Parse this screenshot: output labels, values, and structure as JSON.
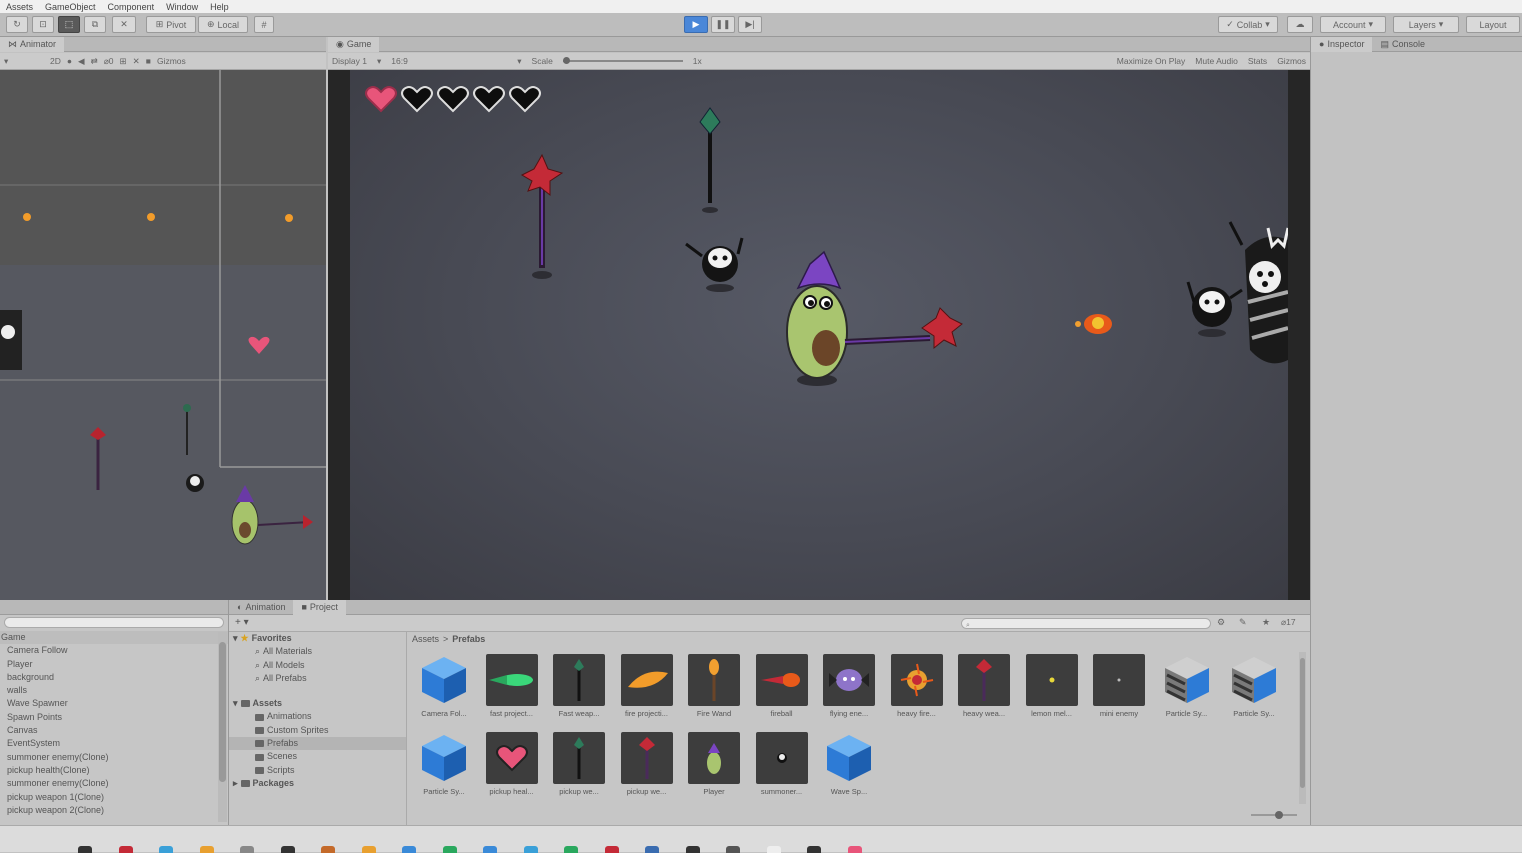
{
  "menu": [
    "Assets",
    "GameObject",
    "Component",
    "Window",
    "Help"
  ],
  "toolbar": {
    "pivot": "Pivot",
    "local": "Local",
    "collab": "Collab",
    "account": "Account",
    "layers": "Layers",
    "layout": "Layout"
  },
  "scene_panel": {
    "tab": "Animator",
    "gizmos": "Gizmos"
  },
  "game_panel": {
    "tab": "Game",
    "display": "Display 1",
    "aspect": "16:9",
    "scale_label": "Scale",
    "scale_value": "1x",
    "maximize_on_play": "Maximize On Play",
    "mute_audio": "Mute Audio",
    "stats": "Stats",
    "gizmos": "Gizmos",
    "hearts_full": 1,
    "hearts_total": 5
  },
  "inspector": {
    "tabs": [
      "Inspector",
      "Console"
    ]
  },
  "hierarchy": {
    "root": "Game",
    "items": [
      "Camera Follow",
      "Player",
      "background",
      "walls",
      "Wave Spawner",
      "Spawn Points",
      "Canvas",
      "EventSystem",
      "summoner enemy(Clone)",
      "pickup health(Clone)",
      "summoner enemy(Clone)",
      "pickup weapon 1(Clone)",
      "pickup weapon 2(Clone)"
    ]
  },
  "project": {
    "tabs": [
      "Animation",
      "Project"
    ],
    "hidden_count": "17",
    "favorites_label": "Favorites",
    "favorites": [
      "All Materials",
      "All Models",
      "All Prefabs"
    ],
    "assets_label": "Assets",
    "asset_folders": [
      "Animations",
      "Custom Sprites",
      "Prefabs",
      "Scenes",
      "Scripts"
    ],
    "packages_label": "Packages",
    "breadcrumb": [
      "Assets",
      "Prefabs"
    ],
    "assets": [
      {
        "label": "Camera Fol...",
        "kind": "cube"
      },
      {
        "label": "fast project...",
        "kind": "green-proj"
      },
      {
        "label": "Fast weap...",
        "kind": "wand-green"
      },
      {
        "label": "fire projecti...",
        "kind": "fire-proj"
      },
      {
        "label": "Fire Wand",
        "kind": "wand-fire"
      },
      {
        "label": "fireball",
        "kind": "fireball"
      },
      {
        "label": "flying ene...",
        "kind": "flyer"
      },
      {
        "label": "heavy fire...",
        "kind": "burst"
      },
      {
        "label": "heavy wea...",
        "kind": "wand-red"
      },
      {
        "label": "lemon mel...",
        "kind": "dot"
      },
      {
        "label": "mini enemy",
        "kind": "dot-small"
      },
      {
        "label": "Particle Sy...",
        "kind": "cube-striped"
      },
      {
        "label": "Particle Sy...",
        "kind": "cube-striped"
      },
      {
        "label": "Particle Sy...",
        "kind": "cube"
      },
      {
        "label": "pickup heal...",
        "kind": "heart"
      },
      {
        "label": "pickup we...",
        "kind": "wand-green"
      },
      {
        "label": "pickup we...",
        "kind": "wand-red"
      },
      {
        "label": "Player",
        "kind": "player"
      },
      {
        "label": "summoner...",
        "kind": "ghost"
      },
      {
        "label": "Wave Sp...",
        "kind": "cube"
      }
    ]
  },
  "colors": {
    "play_active": "#4a87d8",
    "heart": "#e8557a",
    "spawn_point": "#f29c2a"
  }
}
